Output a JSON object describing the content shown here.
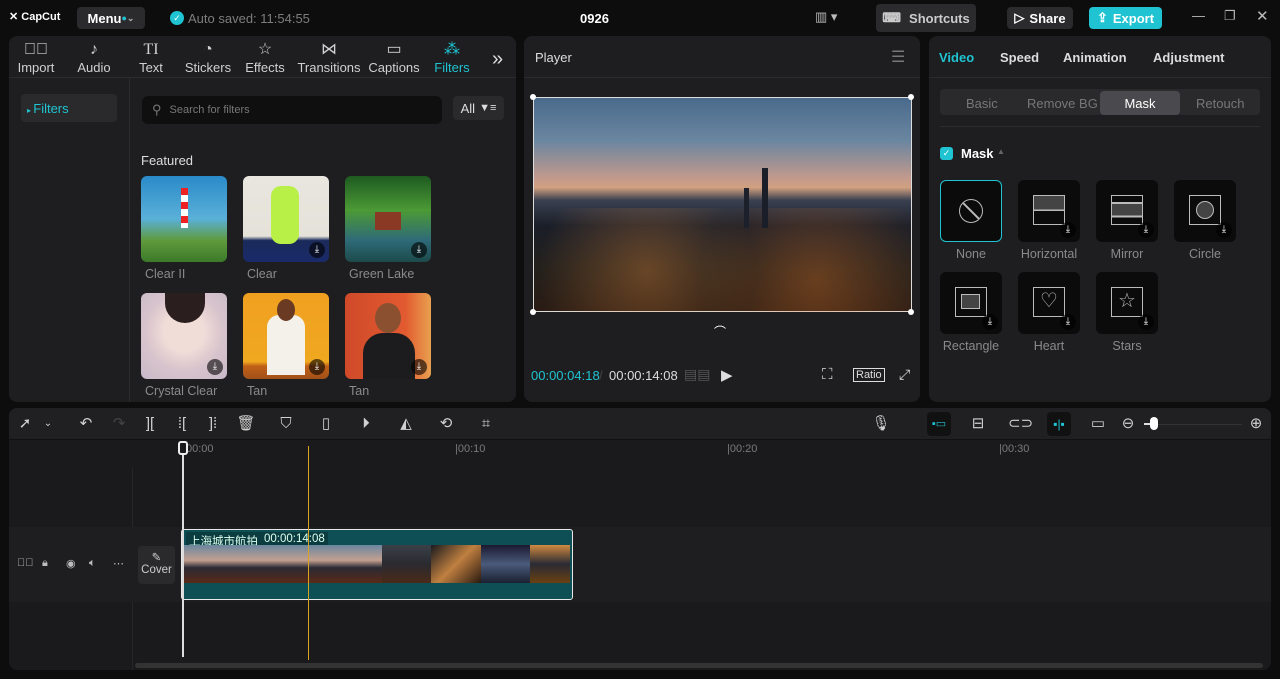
{
  "app": {
    "logo": "CapCut",
    "menu_label": "Menu",
    "autosave": "Auto saved: 11:54:55",
    "project_title": "0926",
    "shortcuts_label": "Shortcuts",
    "share_label": "Share",
    "export_label": "Export"
  },
  "media_tabs": [
    {
      "label": "Import",
      "icon": "import-icon"
    },
    {
      "label": "Audio",
      "icon": "audio-icon"
    },
    {
      "label": "Text",
      "icon": "text-icon"
    },
    {
      "label": "Stickers",
      "icon": "stickers-icon"
    },
    {
      "label": "Effects",
      "icon": "effects-icon"
    },
    {
      "label": "Transitions",
      "icon": "transitions-icon"
    },
    {
      "label": "Captions",
      "icon": "captions-icon"
    },
    {
      "label": "Filters",
      "icon": "filters-icon"
    }
  ],
  "filters": {
    "sidebar_item": "Filters",
    "search_placeholder": "Search for filters",
    "all_label": "All",
    "section": "Featured",
    "items": [
      {
        "label": "Clear II"
      },
      {
        "label": "Clear"
      },
      {
        "label": "Green Lake"
      },
      {
        "label": "Crystal Clear"
      },
      {
        "label": "Tan"
      },
      {
        "label": "Tan"
      }
    ]
  },
  "player": {
    "title": "Player",
    "current_time": "00:00:04:18",
    "total_time": "00:00:14:08",
    "ratio_label": "Ratio"
  },
  "inspector": {
    "tabs": [
      "Video",
      "Speed",
      "Animation",
      "Adjustment"
    ],
    "subtabs": [
      "Basic",
      "Remove BG",
      "Mask",
      "Retouch"
    ],
    "section": "Mask",
    "masks": [
      "None",
      "Horizontal",
      "Mirror",
      "Circle",
      "Rectangle",
      "Heart",
      "Stars"
    ]
  },
  "timeline": {
    "ruler": [
      "00:00",
      "|00:10",
      "|00:20",
      "|00:30"
    ],
    "clip_name": "上海城市航拍",
    "clip_duration": "00:00:14:08",
    "cover_label": "Cover"
  },
  "colors": {
    "accent": "#1fc3d1",
    "clip": "#0e4f55",
    "playhead_yellow": "#d9a520"
  }
}
